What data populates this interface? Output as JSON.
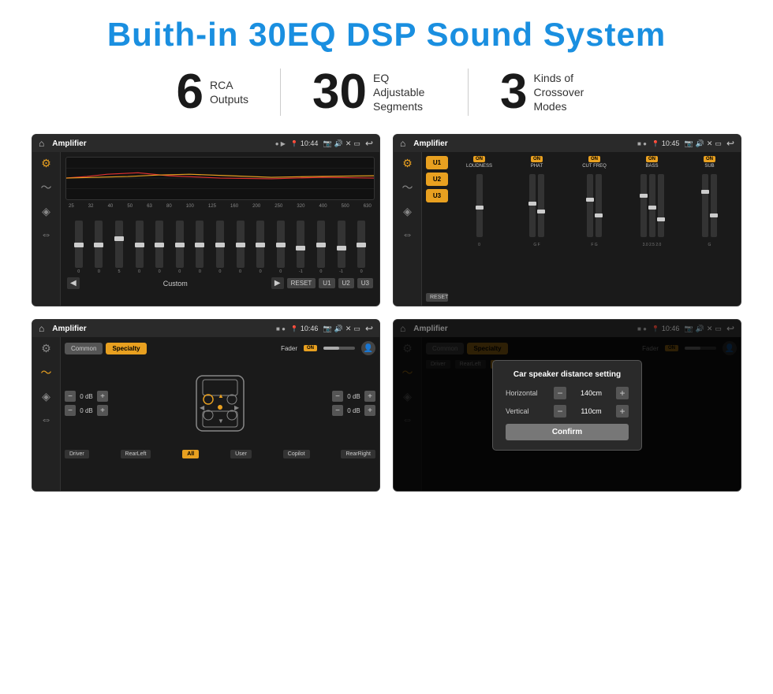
{
  "header": {
    "title": "Buith-in 30EQ DSP Sound System"
  },
  "stats": [
    {
      "number": "6",
      "text_line1": "RCA",
      "text_line2": "Outputs"
    },
    {
      "number": "30",
      "text_line1": "EQ Adjustable",
      "text_line2": "Segments"
    },
    {
      "number": "3",
      "text_line1": "Kinds of",
      "text_line2": "Crossover Modes"
    }
  ],
  "screens": [
    {
      "id": "screen1",
      "statusbar": {
        "title": "Amplifier",
        "time": "10:44",
        "dots": "● ▶"
      },
      "type": "eq"
    },
    {
      "id": "screen2",
      "statusbar": {
        "title": "Amplifier",
        "time": "10:45",
        "dots": "■ ●"
      },
      "type": "amplifier"
    },
    {
      "id": "screen3",
      "statusbar": {
        "title": "Amplifier",
        "time": "10:46",
        "dots": "■ ●"
      },
      "type": "common-specialty"
    },
    {
      "id": "screen4",
      "statusbar": {
        "title": "Amplifier",
        "time": "10:46",
        "dots": "■ ●"
      },
      "type": "modal",
      "modal": {
        "title": "Car speaker distance setting",
        "horizontal_label": "Horizontal",
        "horizontal_value": "140cm",
        "vertical_label": "Vertical",
        "vertical_value": "110cm",
        "confirm_label": "Confirm"
      }
    }
  ],
  "eq": {
    "freqs": [
      "25",
      "32",
      "40",
      "50",
      "63",
      "80",
      "100",
      "125",
      "160",
      "200",
      "250",
      "320",
      "400",
      "500",
      "630"
    ],
    "values": [
      "0",
      "0",
      "0",
      "0",
      "5",
      "0",
      "0",
      "0",
      "0",
      "0",
      "0",
      "0",
      "0",
      "-1",
      "0",
      "-1"
    ],
    "preset_label": "Custom",
    "buttons": [
      "RESET",
      "U1",
      "U2",
      "U3"
    ]
  },
  "amplifier": {
    "presets": [
      "U1",
      "U2",
      "U3"
    ],
    "sections": [
      {
        "label": "LOUDNESS",
        "on": true
      },
      {
        "label": "PHAT",
        "on": true
      },
      {
        "label": "CUT FREQ",
        "on": true
      },
      {
        "label": "BASS",
        "on": true
      },
      {
        "label": "SUB",
        "on": true
      }
    ],
    "reset_label": "RESET"
  },
  "common_specialty": {
    "tabs": [
      "Common",
      "Specialty"
    ],
    "active_tab": "Specialty",
    "fader_label": "Fader",
    "on_label": "ON",
    "channels": [
      {
        "label": "Driver",
        "db": "0 dB"
      },
      {
        "label": "RearLeft",
        "db": "0 dB"
      },
      {
        "label": "Copilot",
        "db": "0 dB"
      },
      {
        "label": "RearRight",
        "db": "0 dB"
      }
    ],
    "buttons": [
      "Driver",
      "RearLeft",
      "All",
      "User",
      "Copilot",
      "RearRight"
    ]
  },
  "modal": {
    "title": "Car speaker distance setting",
    "horizontal_label": "Horizontal",
    "horizontal_value": "140cm",
    "vertical_label": "Vertical",
    "vertical_value": "110cm",
    "confirm_label": "Confirm"
  }
}
